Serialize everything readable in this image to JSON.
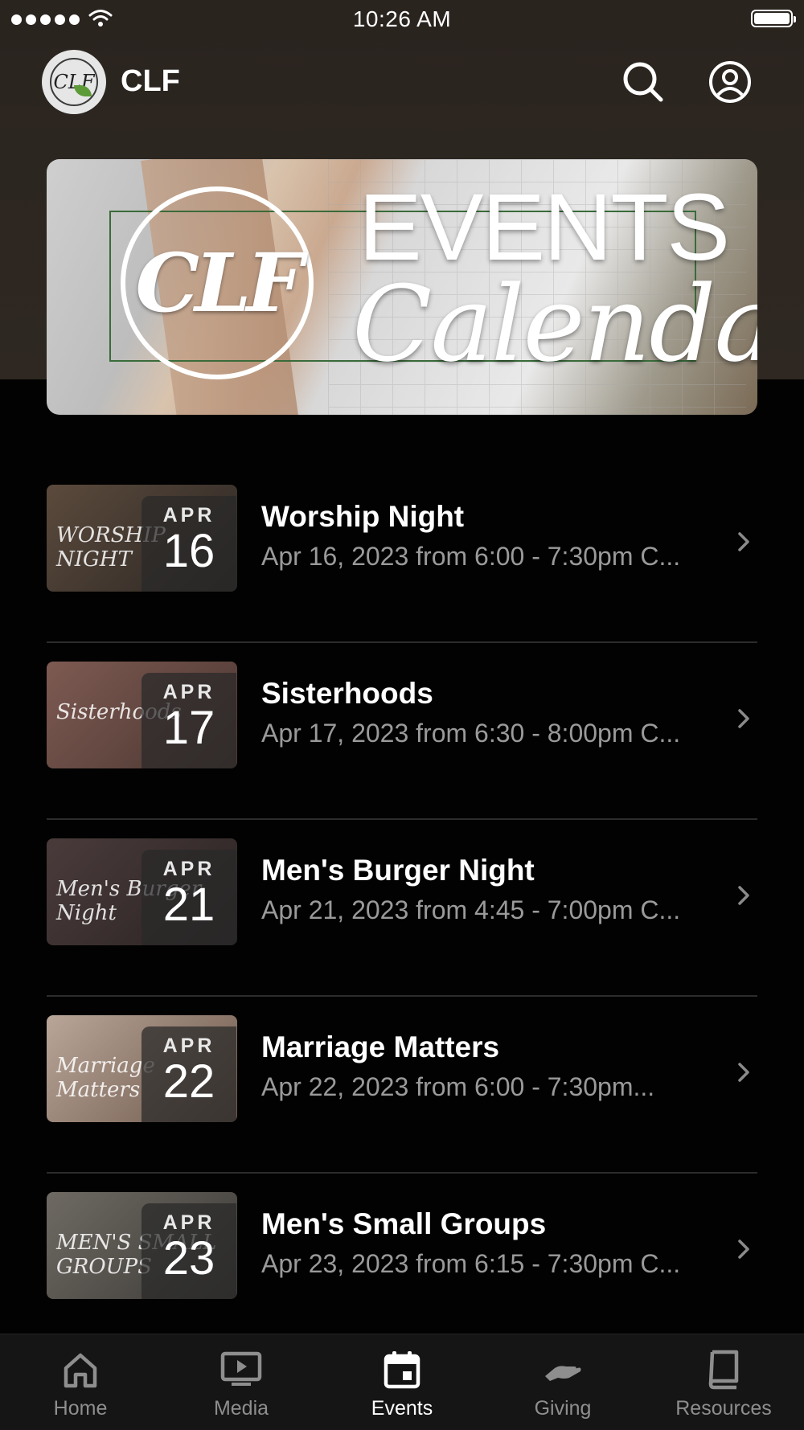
{
  "status_bar": {
    "time": "10:26 AM"
  },
  "header": {
    "app_name": "CLF",
    "logo_text": "CLF"
  },
  "banner": {
    "line1": "EVENTS",
    "line2": "Calendar",
    "logo_text": "CLF"
  },
  "events": [
    {
      "title": "Worship Night",
      "subtitle": "Apr 16, 2023 from 6:00 - 7:30pm C...",
      "month": "APR",
      "day": "16",
      "thumb_text": "WORSHIP NIGHT",
      "thumb_colors": [
        "#5b4a3c",
        "#2c2724"
      ]
    },
    {
      "title": "Sisterhoods",
      "subtitle": "Apr 17, 2023 from 6:30 - 8:00pm C...",
      "month": "APR",
      "day": "17",
      "thumb_text": "Sisterhoods",
      "thumb_colors": [
        "#7d5a52",
        "#4b3631"
      ]
    },
    {
      "title": "Men's Burger Night",
      "subtitle": "Apr 21, 2023 from 4:45 - 7:00pm C...",
      "month": "APR",
      "day": "21",
      "thumb_text": "Men's Burger Night",
      "thumb_colors": [
        "#4a3b3b",
        "#2b2323"
      ]
    },
    {
      "title": "Marriage Matters",
      "subtitle": "Apr 22, 2023 from 6:00 - 7:30pm...",
      "month": "APR",
      "day": "22",
      "thumb_text": "Marriage Matters",
      "thumb_colors": [
        "#b9a698",
        "#6d574b"
      ]
    },
    {
      "title": "Men's Small Groups",
      "subtitle": "Apr 23, 2023 from 6:15 - 7:30pm C...",
      "month": "APR",
      "day": "23",
      "thumb_text": "MEN'S SMALL GROUPS",
      "thumb_colors": [
        "#6e6a63",
        "#3c3a36"
      ]
    }
  ],
  "tabs": [
    {
      "label": "Home",
      "icon": "home-icon",
      "active": false
    },
    {
      "label": "Media",
      "icon": "media-icon",
      "active": false
    },
    {
      "label": "Events",
      "icon": "calendar-icon",
      "active": true
    },
    {
      "label": "Giving",
      "icon": "giving-icon",
      "active": false
    },
    {
      "label": "Resources",
      "icon": "book-icon",
      "active": false
    }
  ],
  "colors": {
    "background": "#020202",
    "header_bg": "#2a241f",
    "tab_active": "#ffffff",
    "tab_inactive": "#8e8e8e",
    "subtitle": "#9a9a9a"
  }
}
